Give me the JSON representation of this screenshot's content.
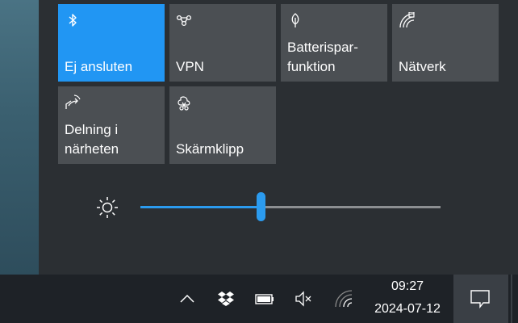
{
  "tiles": [
    {
      "label": "Ej ansluten",
      "icon": "bluetooth-icon",
      "active": true
    },
    {
      "label": "VPN",
      "icon": "vpn-icon",
      "active": false
    },
    {
      "label": "Batterispar-\nfunktion",
      "icon": "battery-saver-leaf-icon",
      "active": false
    },
    {
      "label": "Nätverk",
      "icon": "network-icon",
      "active": false
    },
    {
      "label": "Delning i\nnärheten",
      "icon": "nearby-sharing-icon",
      "active": false
    },
    {
      "label": "Skärmklipp",
      "icon": "snip-scissors-icon",
      "active": false
    }
  ],
  "brightness": {
    "icon": "sun-icon",
    "level": 0.4
  },
  "taskbar": {
    "tray_icons": [
      "chevron-up-icon",
      "dropbox-icon",
      "battery-icon",
      "volume-muted-icon",
      "wifi-icon"
    ],
    "time": "09:27",
    "date": "2024-07-12",
    "notification_icon": "action-center-icon"
  },
  "colors": {
    "accent": "#2196f3",
    "tile": "#4b4f53",
    "panel": "#2b2f33",
    "taskbar": "#1e2227"
  }
}
